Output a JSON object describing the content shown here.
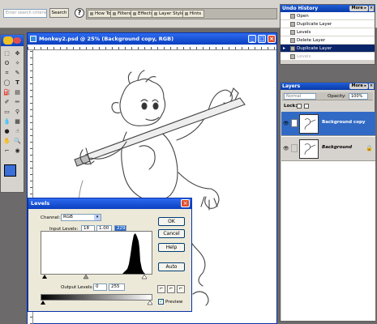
{
  "options_bar": {
    "search_placeholder": "Enter search criteria",
    "search_button": "Search",
    "help_button": "?",
    "tabs": [
      "How To",
      "Filters",
      "Effects",
      "Layer Styles",
      "Hints"
    ]
  },
  "undo_history": {
    "title": "Undo History",
    "more_label": "More ▸",
    "items": [
      {
        "label": "Open",
        "state": "normal"
      },
      {
        "label": "Duplicate Layer",
        "state": "normal"
      },
      {
        "label": "Levels",
        "state": "normal"
      },
      {
        "label": "Delete Layer",
        "state": "normal"
      },
      {
        "label": "Duplicate Layer",
        "state": "selected"
      },
      {
        "label": "Levels",
        "state": "dimmed"
      }
    ]
  },
  "layers": {
    "title": "Layers",
    "more_label": "More ▸",
    "blend_mode": "Normal",
    "opacity_label": "Opacity:",
    "opacity_value": "100%",
    "lock_label": "Lock:",
    "items": [
      {
        "name": "Background copy",
        "selected": true
      },
      {
        "name": "Background",
        "selected": false
      }
    ]
  },
  "document": {
    "title": "Monkey2.psd @ 25% (Background copy, RGB)"
  },
  "levels": {
    "title": "Levels",
    "channel_label": "Channel:",
    "channel_value": "RGB",
    "input_levels_label": "Input Levels:",
    "input_black": "18",
    "input_gamma": "1.00",
    "input_white": "229",
    "output_levels_label": "Output Levels:",
    "output_black": "0",
    "output_white": "255",
    "buttons": {
      "ok": "OK",
      "cancel": "Cancel",
      "help": "Help",
      "auto": "Auto"
    },
    "preview_label": "Preview",
    "preview_checked": true
  },
  "colors": {
    "foreground": "#3b6fd8",
    "background": "#ffffff",
    "title_bar": "#0a3fbf",
    "selection": "#0a246a"
  }
}
